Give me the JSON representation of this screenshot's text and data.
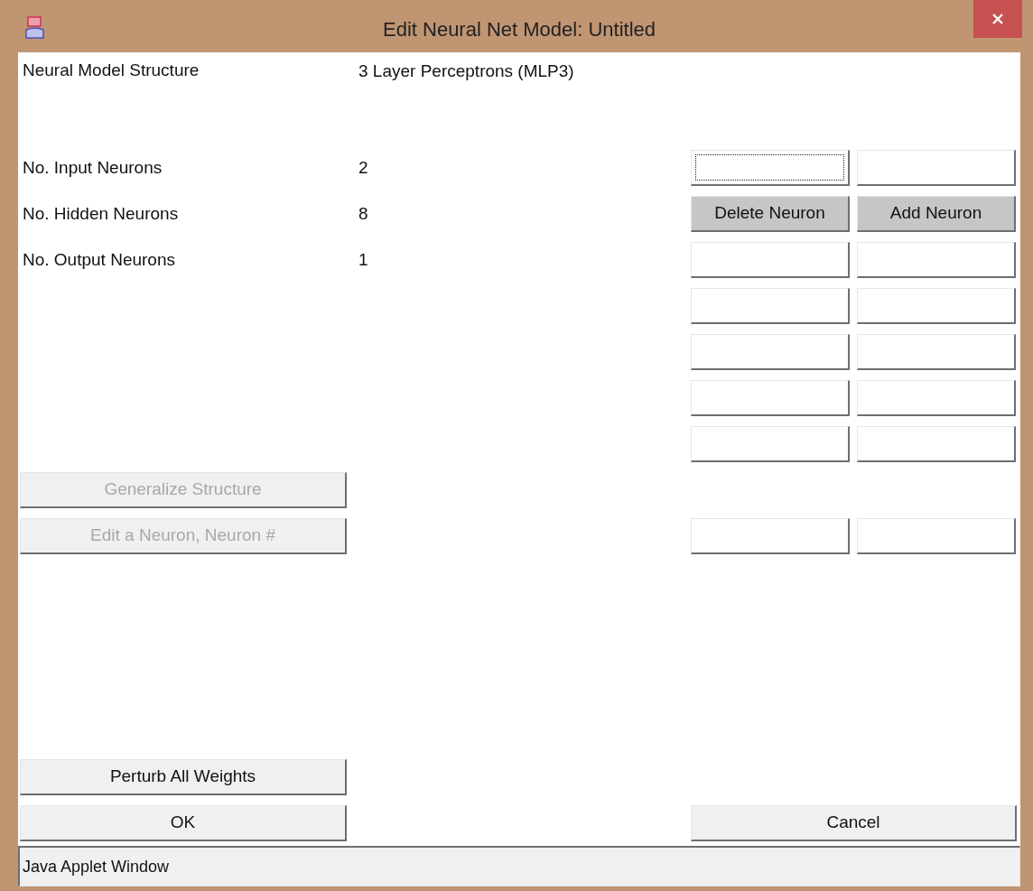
{
  "window": {
    "title": "Edit Neural Net Model: Untitled"
  },
  "structure": {
    "label": "Neural Model Structure",
    "value": "3 Layer Perceptrons (MLP3)"
  },
  "rows": [
    {
      "label": "No. Input Neurons",
      "value": "2",
      "controls": [
        {
          "kind": "field",
          "focused": true
        },
        {
          "kind": "field",
          "focused": false
        }
      ]
    },
    {
      "label": "No. Hidden Neurons",
      "value": "8",
      "controls": [
        {
          "kind": "button",
          "label": "Delete Neuron"
        },
        {
          "kind": "button",
          "label": "Add Neuron"
        }
      ]
    },
    {
      "label": "No. Output Neurons",
      "value": "1",
      "controls": [
        {
          "kind": "field",
          "focused": false
        },
        {
          "kind": "field",
          "focused": false
        }
      ]
    },
    {
      "controls": [
        {
          "kind": "field",
          "focused": false
        },
        {
          "kind": "field",
          "focused": false
        }
      ]
    },
    {
      "controls": [
        {
          "kind": "field",
          "focused": false
        },
        {
          "kind": "field",
          "focused": false
        }
      ]
    },
    {
      "controls": [
        {
          "kind": "field",
          "focused": false
        },
        {
          "kind": "field",
          "focused": false
        }
      ]
    },
    {
      "controls": [
        {
          "kind": "field",
          "focused": false
        },
        {
          "kind": "field",
          "focused": false
        }
      ]
    },
    {
      "action": {
        "label": "Generalize Structure",
        "disabled": true
      }
    },
    {
      "action": {
        "label": "Edit a Neuron, Neuron #",
        "disabled": true
      },
      "controls": [
        {
          "kind": "field",
          "focused": false
        },
        {
          "kind": "field",
          "focused": false
        }
      ]
    }
  ],
  "bottom_rows": [
    {
      "action": {
        "label": "Perturb All Weights",
        "disabled": false
      }
    },
    {
      "action": {
        "label": "OK",
        "disabled": false
      },
      "right": {
        "label": "Cancel",
        "disabled": false
      }
    }
  ],
  "status_bar": "Java Applet Window"
}
